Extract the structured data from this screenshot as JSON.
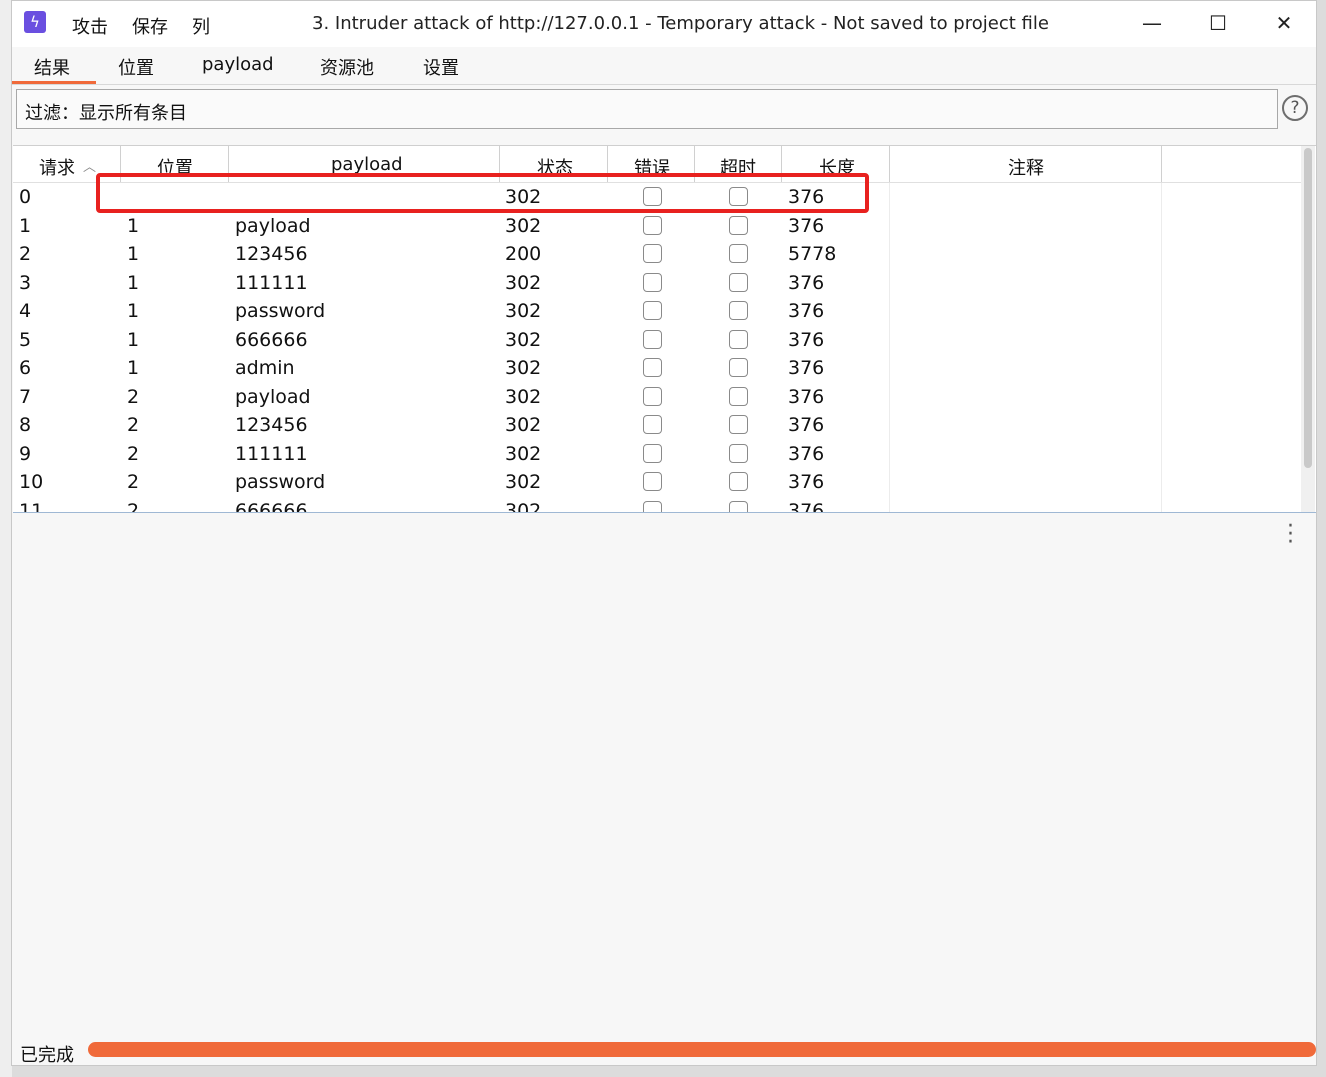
{
  "window": {
    "title": "3. Intruder attack of http://127.0.0.1 - Temporary attack - Not saved to project file",
    "app_icon": "lightning-bolt-icon",
    "menu": [
      "攻击",
      "保存",
      "列"
    ],
    "controls": {
      "minimize": "—",
      "maximize": "☐",
      "close": "✕"
    }
  },
  "tabs": [
    {
      "label": "结果",
      "active": true
    },
    {
      "label": "位置",
      "active": false
    },
    {
      "label": "payload",
      "active": false
    },
    {
      "label": "资源池",
      "active": false
    },
    {
      "label": "设置",
      "active": false
    }
  ],
  "filter": {
    "text": "过滤：显示所有条目",
    "help": "?"
  },
  "table": {
    "columns": [
      "请求",
      "位置",
      "payload",
      "状态",
      "错误",
      "超时",
      "长度",
      "注释"
    ],
    "rows": [
      {
        "request": "0",
        "position": "",
        "payload": "",
        "status": "302",
        "length": "376"
      },
      {
        "request": "1",
        "position": "1",
        "payload": "payload",
        "status": "302",
        "length": "376"
      },
      {
        "request": "2",
        "position": "1",
        "payload": "123456",
        "status": "200",
        "length": "5778"
      },
      {
        "request": "3",
        "position": "1",
        "payload": "111111",
        "status": "302",
        "length": "376"
      },
      {
        "request": "4",
        "position": "1",
        "payload": "password",
        "status": "302",
        "length": "376"
      },
      {
        "request": "5",
        "position": "1",
        "payload": "666666",
        "status": "302",
        "length": "376"
      },
      {
        "request": "6",
        "position": "1",
        "payload": "admin",
        "status": "302",
        "length": "376"
      },
      {
        "request": "7",
        "position": "2",
        "payload": "payload",
        "status": "302",
        "length": "376"
      },
      {
        "request": "8",
        "position": "2",
        "payload": "123456",
        "status": "302",
        "length": "376"
      },
      {
        "request": "9",
        "position": "2",
        "payload": "111111",
        "status": "302",
        "length": "376"
      },
      {
        "request": "10",
        "position": "2",
        "payload": "password",
        "status": "302",
        "length": "376"
      },
      {
        "request": "11",
        "position": "2",
        "payload": "666666",
        "status": "302",
        "length": "376"
      }
    ]
  },
  "status": {
    "text": "已完成",
    "progress": 1.0
  },
  "colors": {
    "accent": "#f06a3a",
    "highlight": "#e8211f",
    "app_icon": "#6a4fe0"
  }
}
